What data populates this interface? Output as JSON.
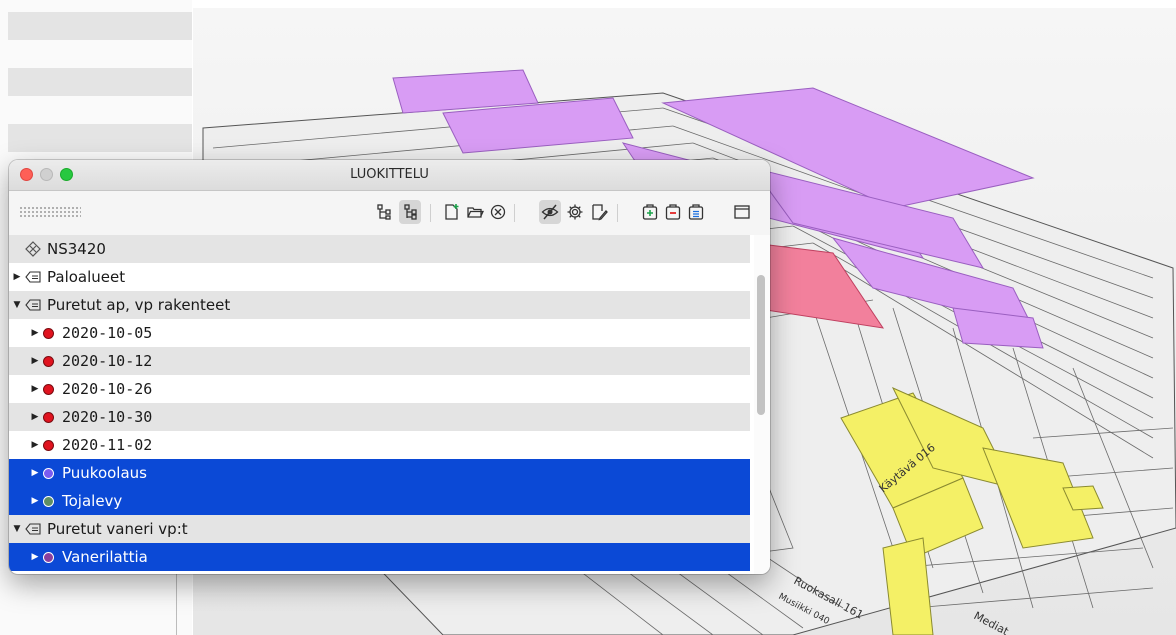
{
  "window": {
    "title": "LUOKITTELU",
    "traffic_lights": {
      "close": "#fe5f57",
      "minimize": "#d0d0d0",
      "maximize": "#28c840"
    }
  },
  "toolbar": {
    "icons": [
      "tree-expand-icon",
      "tree-collapse-icon",
      "new-document-icon",
      "open-folder-icon",
      "clear-icon",
      "visibility-icon",
      "settings-icon",
      "edit-icon",
      "add-icon",
      "remove-icon",
      "list-icon",
      "panel-icon"
    ]
  },
  "tree": {
    "root": {
      "label": "NS3420",
      "icon": "classification-icon"
    },
    "groups": [
      {
        "label": "Paloalueet",
        "expanded": false
      },
      {
        "label": "Puretut ap, vp rakenteet",
        "expanded": true
      },
      {
        "label": "Puretut vaneri vp:t",
        "expanded": true
      }
    ],
    "items": [
      {
        "label": "2020-10-05",
        "color": "#e0131f",
        "selected": false
      },
      {
        "label": "2020-10-12",
        "color": "#e0131f",
        "selected": false
      },
      {
        "label": "2020-10-26",
        "color": "#e0131f",
        "selected": false
      },
      {
        "label": "2020-10-30",
        "color": "#e0131f",
        "selected": false
      },
      {
        "label": "2020-11-02",
        "color": "#e0131f",
        "selected": false
      },
      {
        "label": "Puukoolaus",
        "color": "#7a5cf0",
        "selected": true
      },
      {
        "label": "Tojalevy",
        "color": "#5f8f64",
        "selected": true
      },
      {
        "label": "Vanerilattia",
        "color": "#8a3f9e",
        "selected": true
      }
    ]
  },
  "selection_color": "#0b49d6",
  "floor_plan": {
    "labels": [
      "Käytävä 016",
      "Ruokasali 161",
      "Musiikki 040",
      "Mediat"
    ],
    "highlight_colors": {
      "violet": "#d89cf4",
      "pink": "#f2809c",
      "yellow": "#f4f066"
    }
  }
}
